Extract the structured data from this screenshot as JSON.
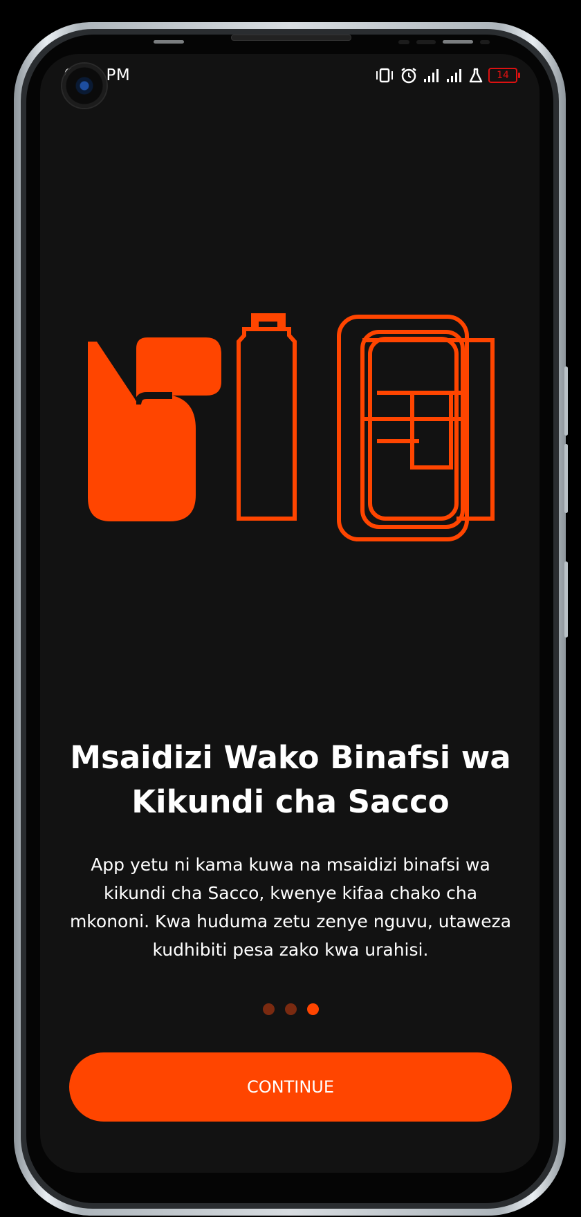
{
  "colors": {
    "accent": "#FF4500",
    "dot_inactive": "#7A2A10",
    "background": "#121212",
    "battery_low": "#DD1111"
  },
  "status_bar": {
    "time": "6:51 PM",
    "battery_level": "14",
    "icons": [
      "vibrate-icon",
      "alarm-icon",
      "signal-icon",
      "signal-icon",
      "lab-flask-icon",
      "battery-icon"
    ]
  },
  "illustration": {
    "semantic": "stylized-brand-letters",
    "glyphs": [
      "b-shape-filled",
      "i-shape-outline",
      "phone-wallet-outline"
    ]
  },
  "onboarding": {
    "title": "Msaidizi Wako Binafsi wa Kikundi cha Sacco",
    "description": "App yetu ni kama kuwa na msaidizi binafsi wa kikundi cha Sacco, kwenye kifaa chako cha mkononi. Kwa huduma zetu zenye nguvu, utaweza kudhibiti pesa zako kwa urahisi.",
    "page_indicator": {
      "total_pages": 3,
      "current_page": 3
    },
    "continue_label": "CONTINUE"
  }
}
